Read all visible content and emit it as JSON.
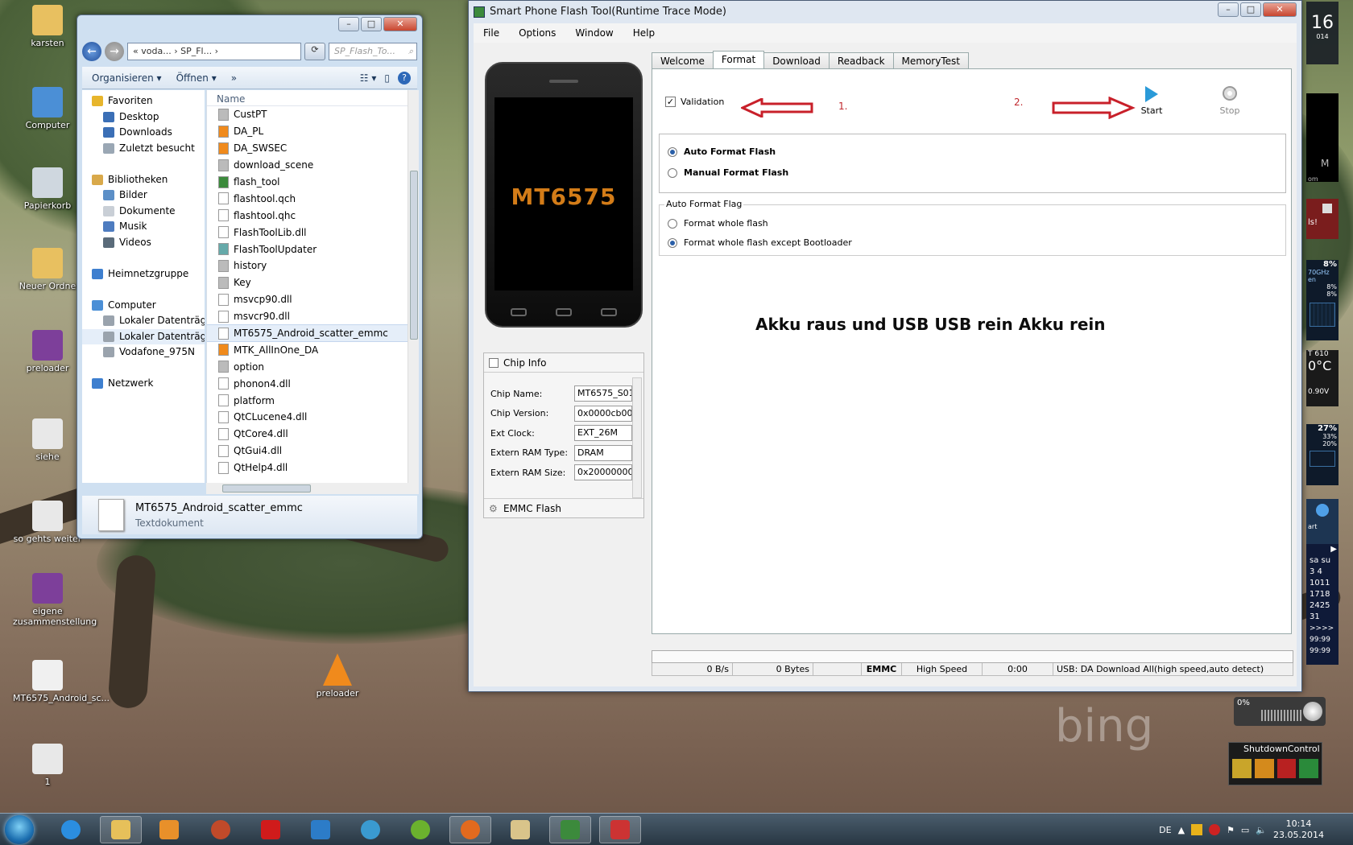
{
  "desktop": {
    "icons": [
      {
        "label": "karsten",
        "color": "#e8c060"
      },
      {
        "label": "Computer",
        "color": "#4b8fd6"
      },
      {
        "label": "Papierkorb",
        "color": "#cfd7df"
      },
      {
        "label": "Neuer Ordne",
        "color": "#e8c060"
      },
      {
        "label": "preloader",
        "color": "#7d3f9a"
      },
      {
        "label": "siehe",
        "color": "#e8e8e8"
      },
      {
        "label": "so gehts weiter",
        "color": "#e8e8e8"
      },
      {
        "label": "eigene zusammenstellung",
        "color": "#7d3f9a"
      },
      {
        "label": "MT6575_Android_sc...",
        "color": "#f0f0f0"
      },
      {
        "label": "1",
        "color": "#e8e8e8"
      }
    ],
    "vlc_label": "preloader",
    "bing_label": "bing"
  },
  "explorer": {
    "address": [
      "«",
      "voda...",
      "›",
      "SP_Fl...",
      "›"
    ],
    "search_placeholder": "SP_Flash_To...",
    "toolbar": {
      "organize": "Organisieren",
      "open": "Öffnen",
      "more": "»"
    },
    "nav": [
      {
        "label": "Favoriten",
        "indent": 0,
        "color": "#e7b52c"
      },
      {
        "label": "Desktop",
        "indent": 1,
        "color": "#3b6fb6"
      },
      {
        "label": "Downloads",
        "indent": 1,
        "color": "#3b6fb6"
      },
      {
        "label": "Zuletzt besucht",
        "indent": 1,
        "color": "#9aa7b4"
      },
      {
        "label": "",
        "indent": 0,
        "color": ""
      },
      {
        "label": "Bibliotheken",
        "indent": 0,
        "color": "#d9a94a"
      },
      {
        "label": "Bilder",
        "indent": 1,
        "color": "#5c8fc7"
      },
      {
        "label": "Dokumente",
        "indent": 1,
        "color": "#c9cfd6"
      },
      {
        "label": "Musik",
        "indent": 1,
        "color": "#4e7cc0"
      },
      {
        "label": "Videos",
        "indent": 1,
        "color": "#5a6b7a"
      },
      {
        "label": "",
        "indent": 0,
        "color": ""
      },
      {
        "label": "Heimnetzgruppe",
        "indent": 0,
        "color": "#3e7fcf"
      },
      {
        "label": "",
        "indent": 0,
        "color": ""
      },
      {
        "label": "Computer",
        "indent": 0,
        "color": "#4b8fd6"
      },
      {
        "label": "Lokaler Datenträger",
        "indent": 1,
        "color": "#9aa3ad"
      },
      {
        "label": "Lokaler Datenträger",
        "indent": 1,
        "color": "#9aa3ad"
      },
      {
        "label": "Vodafone_975N",
        "indent": 1,
        "color": "#9aa3ad"
      },
      {
        "label": "",
        "indent": 0,
        "color": ""
      },
      {
        "label": "Netzwerk",
        "indent": 0,
        "color": "#3e7fcf"
      }
    ],
    "column_header": "Name",
    "files": [
      "CustPT",
      "DA_PL",
      "DA_SWSEC",
      "download_scene",
      "flash_tool",
      "flashtool.qch",
      "flashtool.qhc",
      "FlashToolLib.dll",
      "FlashToolUpdater",
      "history",
      "Key",
      "msvcp90.dll",
      "msvcr90.dll",
      "MT6575_Android_scatter_emmc",
      "MTK_AllInOne_DA",
      "option",
      "phonon4.dll",
      "platform",
      "QtCLucene4.dll",
      "QtCore4.dll",
      "QtGui4.dll",
      "QtHelp4.dll"
    ],
    "selected_file": "MT6575_Android_scatter_emmc",
    "details": {
      "name": "MT6575_Android_scatter_emmc",
      "type": "Textdokument"
    }
  },
  "flash": {
    "title": "Smart Phone Flash Tool(Runtime Trace Mode)",
    "menu": [
      "File",
      "Options",
      "Window",
      "Help"
    ],
    "phone_chip": "MT6575",
    "tabs": [
      "Welcome",
      "Format",
      "Download",
      "Readback",
      "MemoryTest"
    ],
    "active_tab": "Format",
    "validation_label": "Validation",
    "step1": "1.",
    "step2": "2.",
    "start_label": "Start",
    "stop_label": "Stop",
    "auto_format": "Auto Format Flash",
    "manual_format": "Manual Format Flash",
    "flag_title": "Auto Format Flag",
    "flag_whole": "Format whole flash",
    "flag_except": "Format whole flash except Bootloader",
    "note": "Akku raus und USB USB rein Akku rein",
    "chip_info": {
      "title": "Chip Info",
      "rows": [
        {
          "label": "Chip Name:",
          "value": "MT6575_S01"
        },
        {
          "label": "Chip Version:",
          "value": "0x0000cb00"
        },
        {
          "label": "Ext Clock:",
          "value": "EXT_26M"
        },
        {
          "label": "Extern RAM Type:",
          "value": "DRAM"
        },
        {
          "label": "Extern RAM Size:",
          "value": "0x20000000"
        }
      ],
      "emmc": "EMMC Flash"
    },
    "status": {
      "rate": "0 B/s",
      "bytes": "0 Bytes",
      "storage": "EMMC",
      "speed": "High Speed",
      "time": "0:00",
      "usb": "USB: DA Download All(high speed,auto detect)"
    }
  },
  "gadgets": {
    "cpu": "8%",
    "cpu2": "8%",
    "cpu3": "8%",
    "freq": "70GHz",
    "temp": "0°C",
    "gpu": "610",
    "volt": "0.90V",
    "ram": "27%",
    "ram2": "33%",
    "ram3": "20%",
    "vol": "0%",
    "shutdown": "ShutdownControl",
    "cal_headers": [
      "sa",
      "su"
    ],
    "cal_rows": [
      "3 4",
      "1011",
      "1718",
      "2425",
      "31"
    ],
    "date_top": "16",
    "date_sub": "014",
    "misc_m": "M",
    "misc_com": "om",
    "misc_ls": "ls!",
    "misc_en": "en",
    "misc_t": "T",
    "misc_art": "art",
    "arrows": ">>>>",
    "n1": "99:99",
    "n2": "99:99"
  },
  "taskbar": {
    "lang": "DE",
    "time": "10:14",
    "date": "23.05.2014"
  }
}
